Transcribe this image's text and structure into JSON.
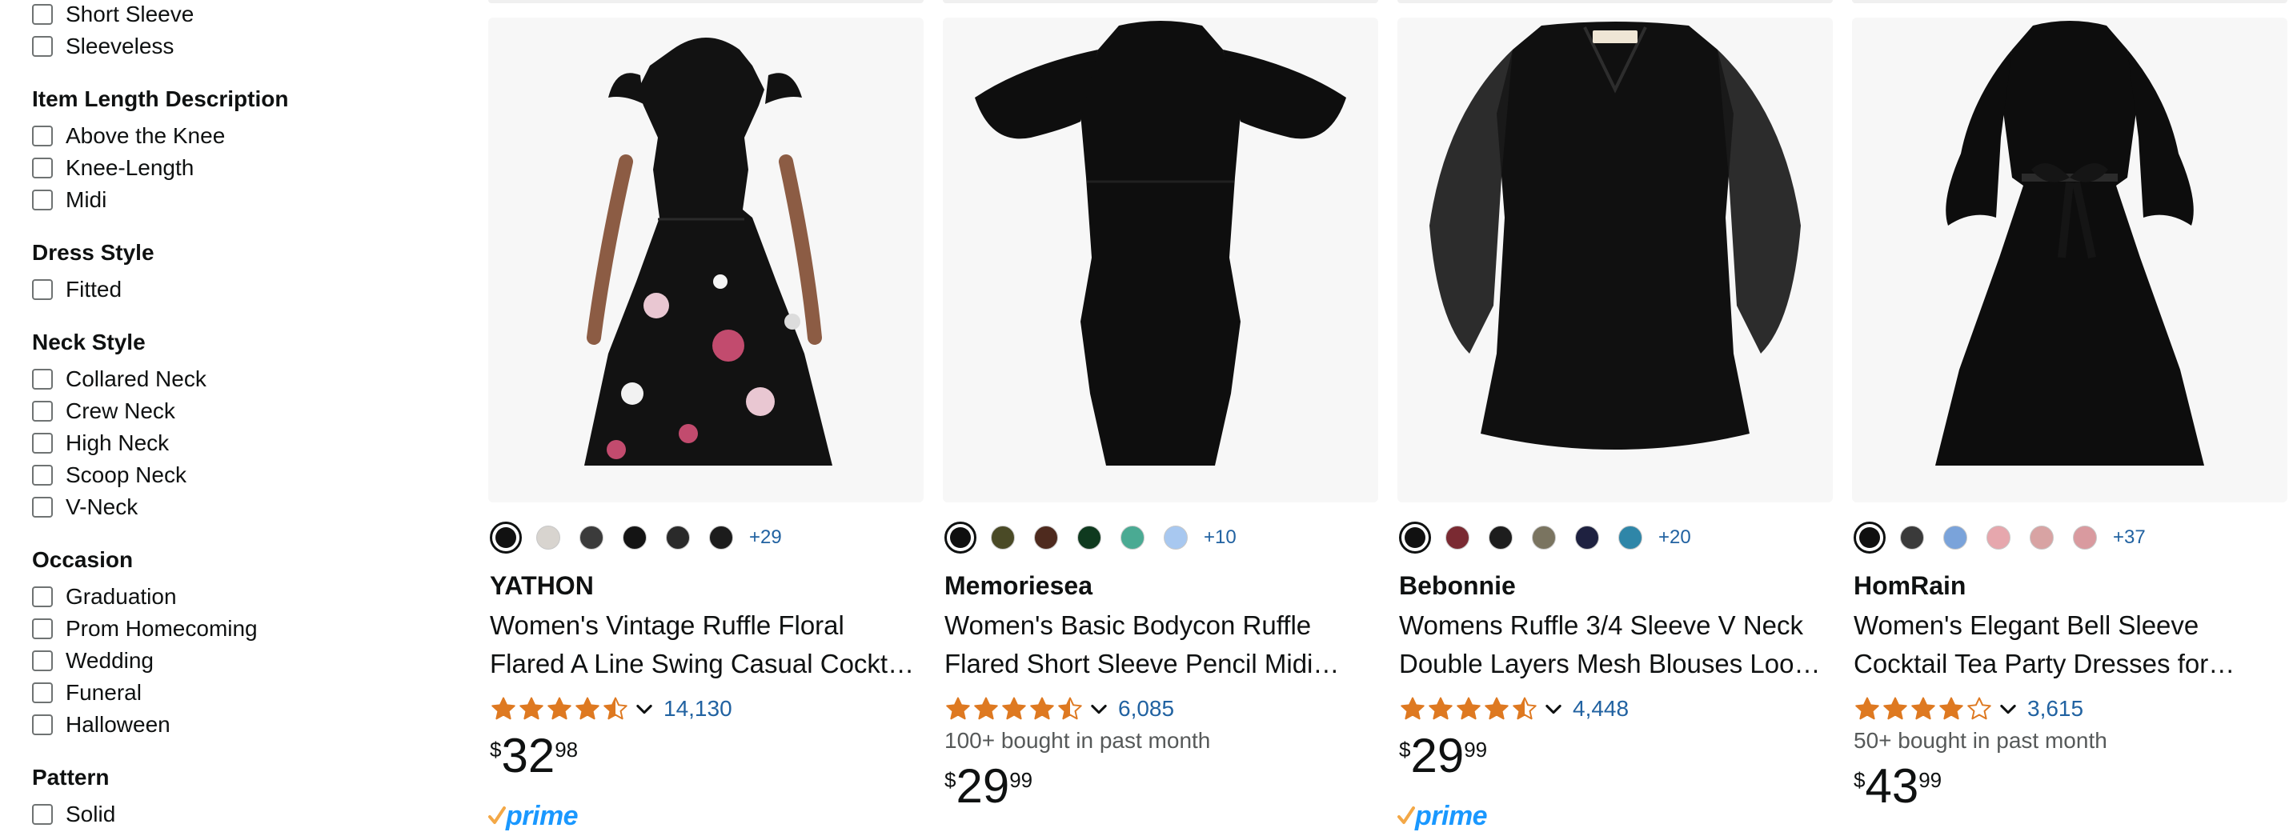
{
  "sidebar": {
    "groups": [
      {
        "heading": "",
        "options": [
          "Short Sleeve",
          "Sleeveless"
        ]
      },
      {
        "heading": "Item Length Description",
        "options": [
          "Above the Knee",
          "Knee-Length",
          "Midi"
        ]
      },
      {
        "heading": "Dress Style",
        "options": [
          "Fitted"
        ]
      },
      {
        "heading": "Neck Style",
        "options": [
          "Collared Neck",
          "Crew Neck",
          "High Neck",
          "Scoop Neck",
          "V-Neck"
        ]
      },
      {
        "heading": "Occasion",
        "options": [
          "Graduation",
          "Prom Homecoming",
          "Wedding",
          "Funeral",
          "Halloween"
        ]
      },
      {
        "heading": "Pattern",
        "options": [
          "Solid"
        ]
      }
    ]
  },
  "products": [
    {
      "brand": "YATHON",
      "title": "Women's Vintage Ruffle Floral Flared A Line Swing Casual Cocktail Party Dresses",
      "swatches": [
        "#111111",
        "#d8d4cf",
        "#3b3b3b",
        "#141414",
        "#2a2a2a",
        "#1c1c1c"
      ],
      "more_colors": "+29",
      "rating": 4.5,
      "reviews": "14,130",
      "bought": "",
      "price": {
        "symbol": "$",
        "whole": "32",
        "fraction": "98"
      },
      "prime": "prime",
      "dress_color": "#121212"
    },
    {
      "brand": "Memoriesea",
      "title": "Women's Basic Bodycon Ruffle Flared Short Sleeve Pencil Midi Dress",
      "swatches": [
        "#0f0f0f",
        "#4a4a26",
        "#4e2a1e",
        "#0f3a1f",
        "#4aaa93",
        "#a8c8f0"
      ],
      "more_colors": "+10",
      "rating": 4.5,
      "reviews": "6,085",
      "bought": "100+ bought in past month",
      "price": {
        "symbol": "$",
        "whole": "29",
        "fraction": "99"
      },
      "prime": "",
      "dress_color": "#0e0e0e"
    },
    {
      "brand": "Bebonnie",
      "title": "Womens Ruffle 3/4 Sleeve V Neck Double Layers Mesh Blouses Loose Tunic Dress",
      "swatches": [
        "#111111",
        "#7a2a32",
        "#1d1d1d",
        "#7a7460",
        "#1e2140",
        "#2f86a8"
      ],
      "more_colors": "+20",
      "rating": 4.5,
      "reviews": "4,448",
      "bought": "",
      "price": {
        "symbol": "$",
        "whole": "29",
        "fraction": "99"
      },
      "prime": "prime",
      "dress_color": "#101010"
    },
    {
      "brand": "HomRain",
      "title": "Women's Elegant Bell Sleeve Cocktail Tea Party Dresses for Wedding Guest",
      "swatches": [
        "#101010",
        "#3a3a3a",
        "#7aa3da",
        "#e6a7ad",
        "#d8a3a3",
        "#d99a9f"
      ],
      "more_colors": "+37",
      "rating": 4.0,
      "reviews": "3,615",
      "bought": "50+ bought in past month",
      "price": {
        "symbol": "$",
        "whole": "43",
        "fraction": "99"
      },
      "prime": "",
      "dress_color": "#0d0d0d"
    }
  ],
  "colors": {
    "link": "#2162a1",
    "star": "#de7921",
    "prime": "#1a98ff",
    "text": "#0f1111"
  },
  "icons": {
    "rating_dropdown": "chevron-down-icon",
    "prime": "prime-check-icon",
    "star": "star-icon"
  }
}
